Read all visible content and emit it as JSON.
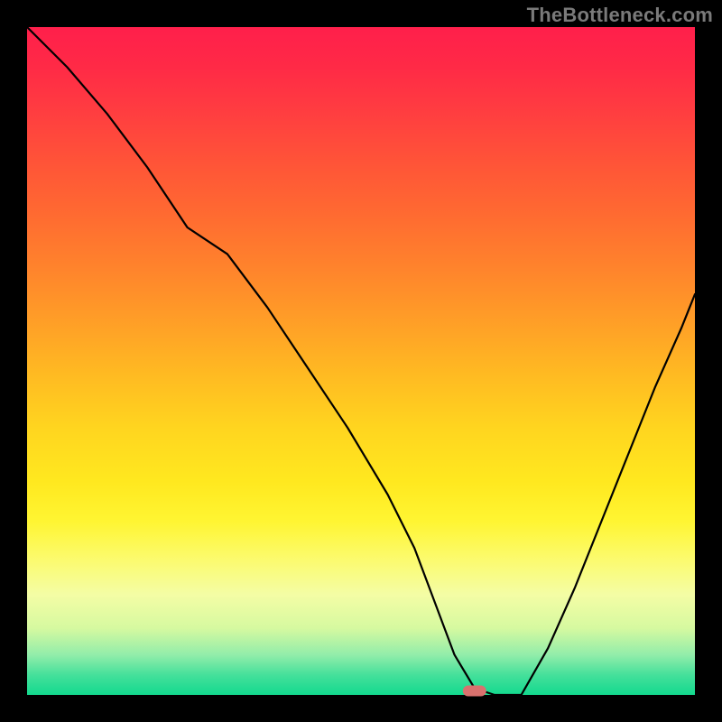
{
  "watermark": "TheBottleneck.com",
  "chart_data": {
    "type": "line",
    "title": "",
    "xlabel": "",
    "ylabel": "",
    "xlim": [
      0,
      100
    ],
    "ylim": [
      0,
      100
    ],
    "background_gradient": {
      "orientation": "vertical",
      "stops": [
        {
          "pos": 0.0,
          "color": "#ff1f4b"
        },
        {
          "pos": 0.5,
          "color": "#ffcf22"
        },
        {
          "pos": 0.8,
          "color": "#fbfb71"
        },
        {
          "pos": 1.0,
          "color": "#13d98e"
        }
      ]
    },
    "series": [
      {
        "name": "bottleneck-curve",
        "x": [
          0,
          6,
          12,
          18,
          24,
          30,
          36,
          42,
          48,
          54,
          58,
          61,
          64,
          67,
          70,
          74,
          78,
          82,
          86,
          90,
          94,
          98,
          100
        ],
        "y": [
          100,
          94,
          87,
          79,
          70,
          66,
          58,
          49,
          40,
          30,
          22,
          14,
          6,
          1,
          0,
          0,
          7,
          16,
          26,
          36,
          46,
          55,
          60
        ]
      }
    ],
    "marker": {
      "x": 67,
      "y": 0.6,
      "color": "#d9716e",
      "shape": "rounded-rect"
    }
  }
}
